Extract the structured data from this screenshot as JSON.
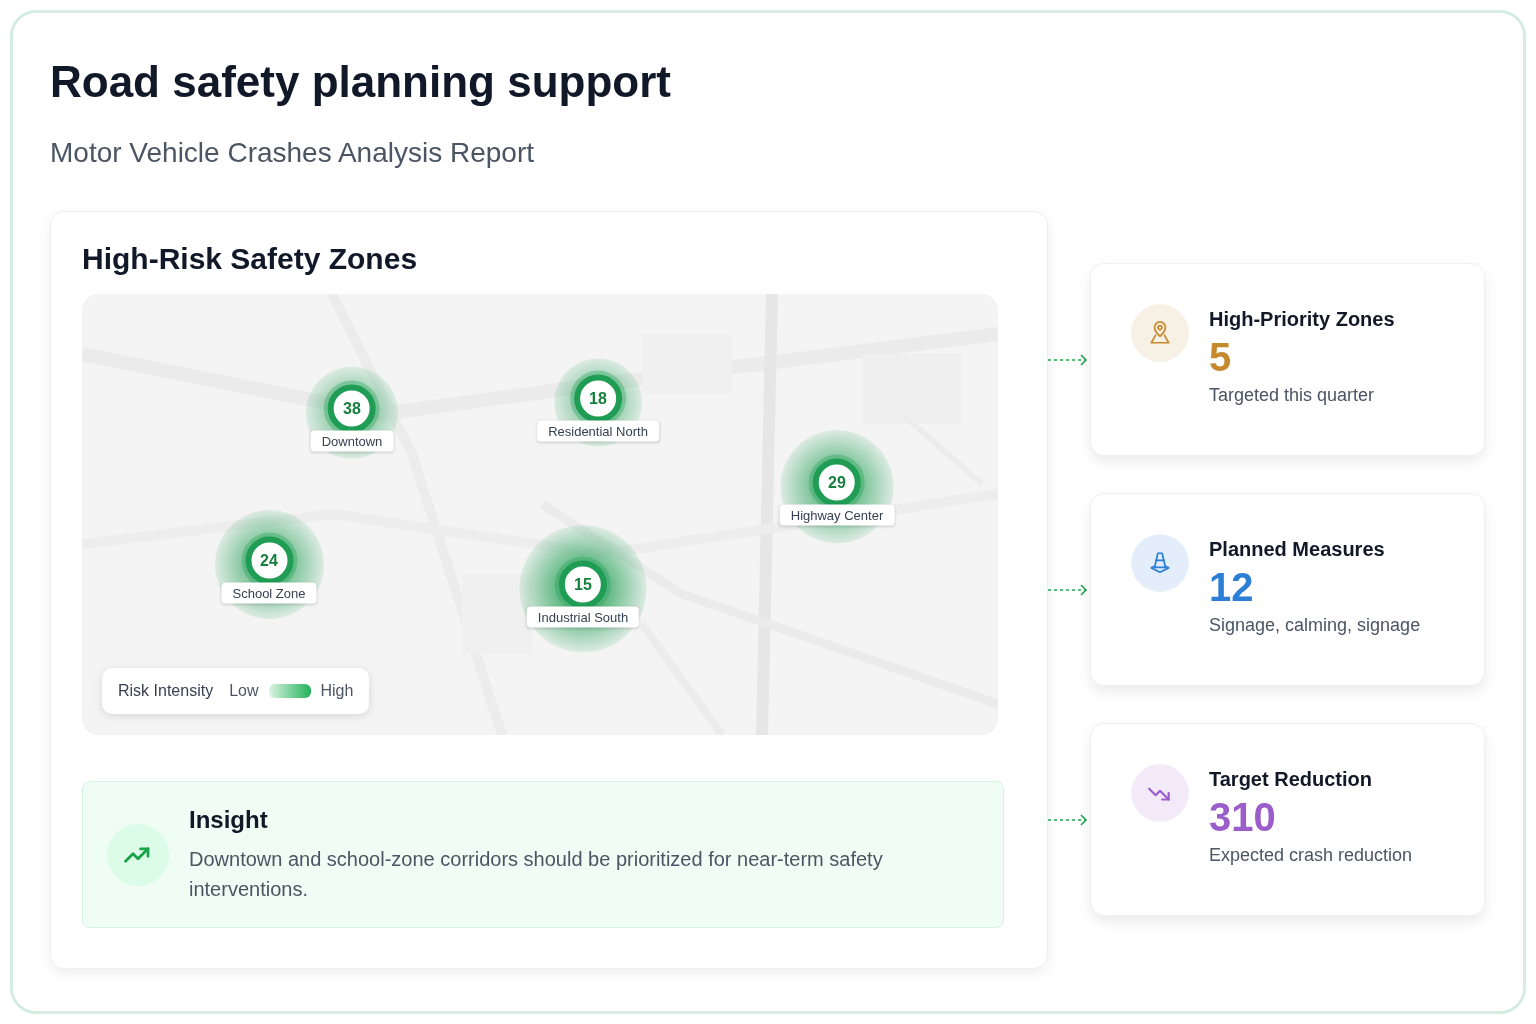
{
  "header": {
    "title": "Road safety planning support",
    "subtitle": "Motor Vehicle Crashes Analysis Report"
  },
  "zones_panel": {
    "title": "High-Risk Safety Zones",
    "zones": [
      {
        "count": "38",
        "name": "Downtown"
      },
      {
        "count": "18",
        "name": "Residential North"
      },
      {
        "count": "29",
        "name": "Highway Center"
      },
      {
        "count": "24",
        "name": "School Zone"
      },
      {
        "count": "15",
        "name": "Industrial South"
      }
    ],
    "legend": {
      "title": "Risk Intensity",
      "low": "Low",
      "high": "High"
    },
    "insight": {
      "title": "Insight",
      "text": "Downtown and school-zone corridors should be prioritized for near-term safety interventions."
    }
  },
  "stats": [
    {
      "title": "High-Priority Zones",
      "value": "5",
      "caption": "Targeted this quarter",
      "color": "#c48a2c"
    },
    {
      "title": "Planned Measures",
      "value": "12",
      "caption": "Signage, calming, signage",
      "color": "#2d7fd6"
    },
    {
      "title": "Target Reduction",
      "value": "310",
      "caption": "Expected crash reduction",
      "color": "#9b5dc9"
    }
  ]
}
